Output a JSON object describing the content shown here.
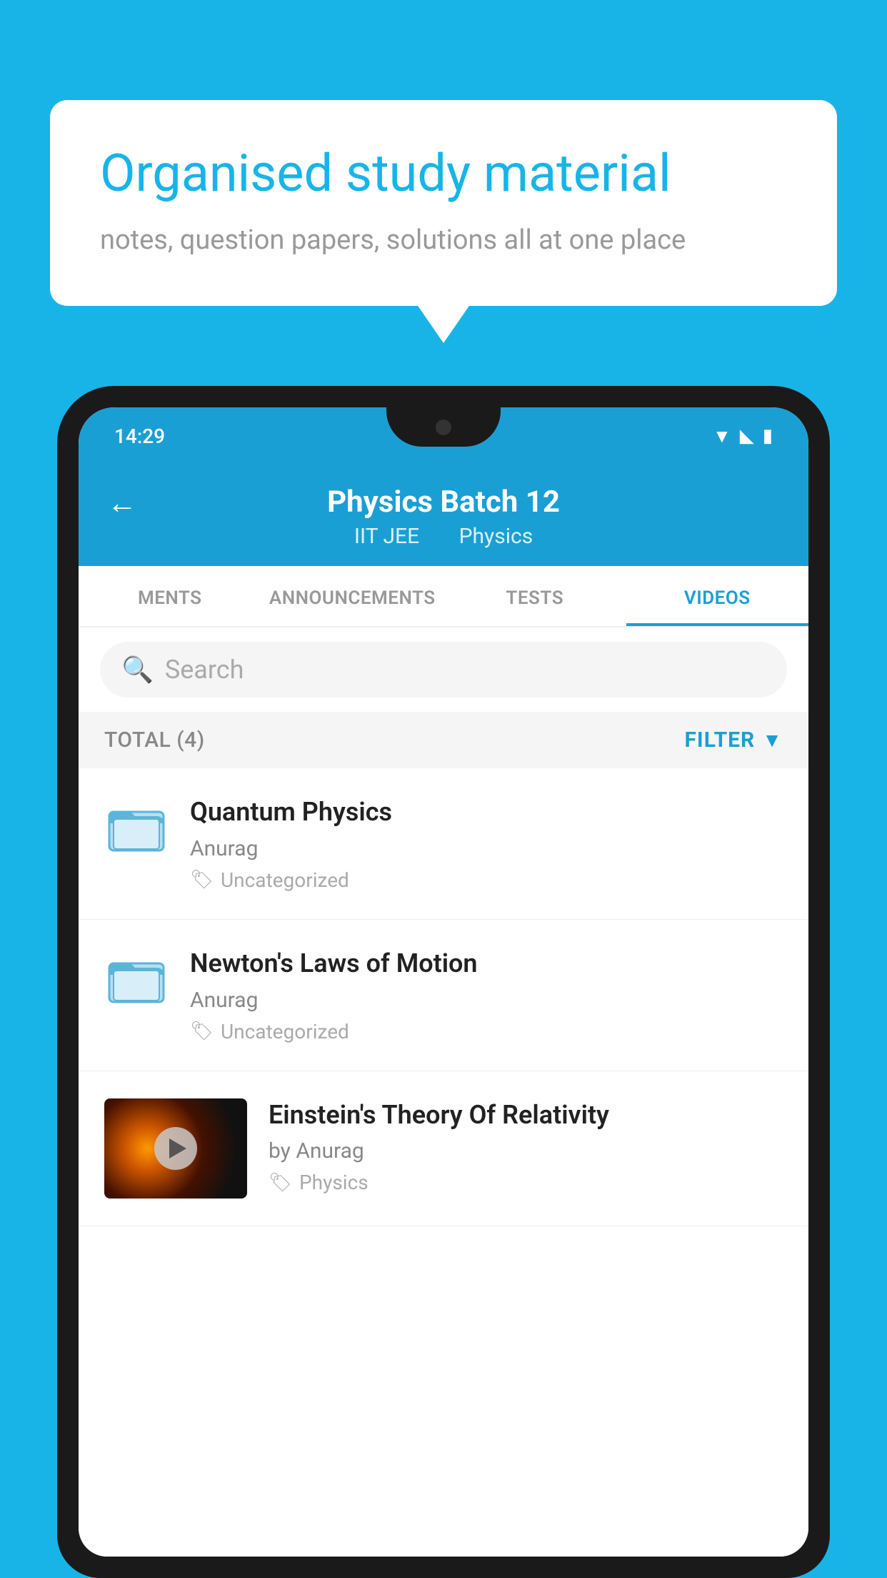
{
  "background_color": "#18B4E8",
  "bubble": {
    "title": "Organised study material",
    "subtitle": "notes, question papers, solutions all at one place"
  },
  "status_bar": {
    "time": "14:29",
    "icons": [
      "wifi",
      "signal",
      "battery"
    ]
  },
  "app_header": {
    "back_label": "←",
    "title": "Physics Batch 12",
    "tag1": "IIT JEE",
    "tag2": "Physics"
  },
  "tabs": [
    {
      "label": "MENTS",
      "active": false
    },
    {
      "label": "ANNOUNCEMENTS",
      "active": false
    },
    {
      "label": "TESTS",
      "active": false
    },
    {
      "label": "VIDEOS",
      "active": true
    }
  ],
  "search": {
    "placeholder": "Search"
  },
  "filter": {
    "total_label": "TOTAL (4)",
    "filter_label": "FILTER"
  },
  "videos": [
    {
      "title": "Quantum Physics",
      "author": "Anurag",
      "tag": "Uncategorized",
      "has_thumbnail": false
    },
    {
      "title": "Newton's Laws of Motion",
      "author": "Anurag",
      "tag": "Uncategorized",
      "has_thumbnail": false
    },
    {
      "title": "Einstein's Theory Of Relativity",
      "author": "by Anurag",
      "tag": "Physics",
      "has_thumbnail": true
    }
  ]
}
